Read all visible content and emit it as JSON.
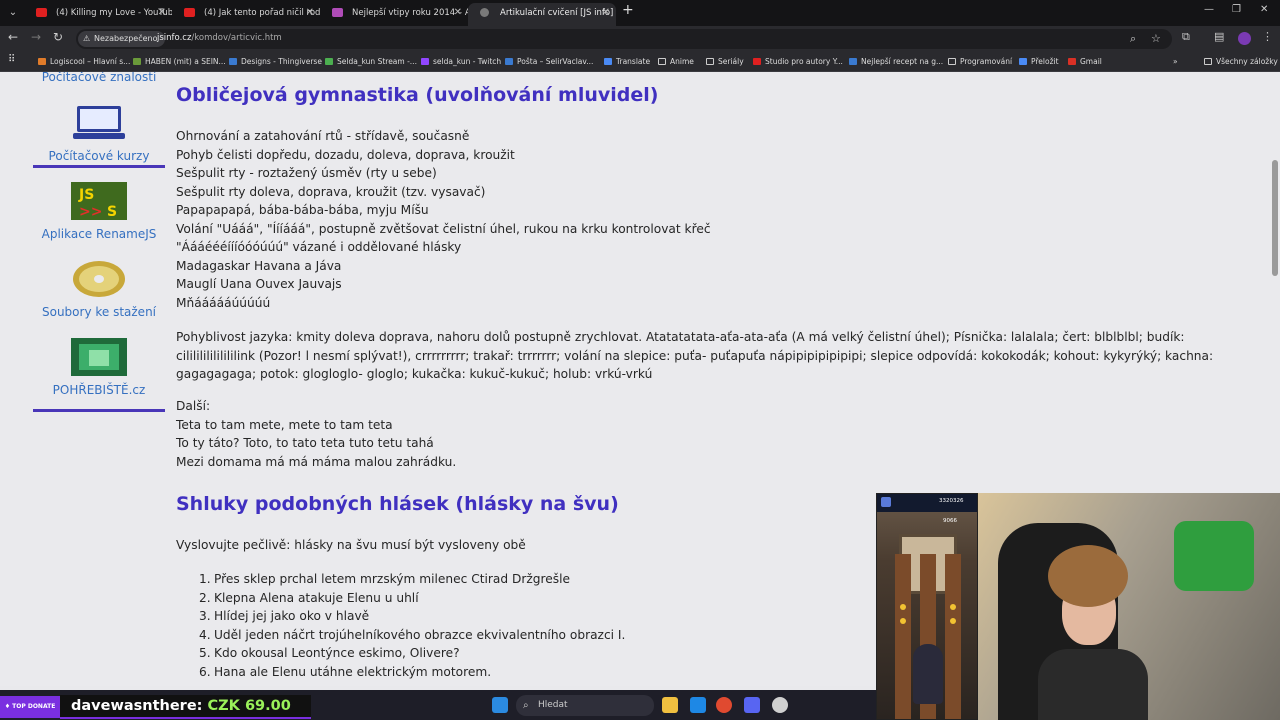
{
  "browser": {
    "tabs": [
      {
        "title": "(4) Killing my Love - YouTube",
        "favicon_color": "#e02020"
      },
      {
        "title": "(4) Jak tento pořad ničil rodin",
        "favicon_color": "#e02020"
      },
      {
        "title": "Nejlepší vtipy roku 2014 – Alik",
        "favicon_color": "#b04cb8"
      },
      {
        "title": "Artikulační cvičení [JS info]",
        "favicon_color": "#7a7a7a"
      }
    ],
    "security_label": "Nezabezpečeno",
    "url_host": "jsinfo.cz",
    "url_path": "/komdov/articvic.htm",
    "bookmarks": [
      {
        "label": "Logiscool – Hlavní s...",
        "color": "#e07b2a"
      },
      {
        "label": "HABEN (mit) a SEIN...",
        "color": "#6a9a3a"
      },
      {
        "label": "Designs - Thingiverse",
        "color": "#3a7ad0"
      },
      {
        "label": "Selda_kun Stream -...",
        "color": "#4caf50"
      },
      {
        "label": "selda_kun - Twitch",
        "color": "#9146ff"
      },
      {
        "label": "Pošta – SelirVaclav...",
        "color": "#3a7ad0"
      },
      {
        "label": "Translate",
        "color": "#4a8af4"
      },
      {
        "label": "Anime",
        "folder": true
      },
      {
        "label": "Seriály",
        "folder": true
      },
      {
        "label": "Studio pro autory Y...",
        "color": "#e02020"
      },
      {
        "label": "Nejlepší recept na g...",
        "color": "#3a7ad0"
      },
      {
        "label": "Programování",
        "folder": true
      },
      {
        "label": "Přeložit",
        "color": "#4a8af4"
      },
      {
        "label": "Gmail",
        "color": "#d93025"
      }
    ],
    "all_bookmarks": "Všechny záložky"
  },
  "sidebar": {
    "top_label": "Počítačové znalosti",
    "items": [
      {
        "label": "Počítačové kurzy",
        "icon": "laptop-icon"
      },
      {
        "label": "Aplikace RenameJS",
        "icon": "renamejs-logo"
      },
      {
        "label": "Soubory ke stažení",
        "icon": "disc-icon"
      },
      {
        "label": "POHŘEBIŠTĚ.cz",
        "icon": "cemetery-icon"
      }
    ]
  },
  "main": {
    "section1_title": "Obličejová gymnastika (uvolňování mluvidel)",
    "section1_lines": [
      "Ohrnování a zatahování rtů - střídavě, současně",
      "Pohyb čelisti dopředu, dozadu, doleva, doprava, kroužit",
      "Sešpulit rty - roztažený úsměv (rty u sebe)",
      "Sešpulit rty doleva, doprava, kroužit (tzv. vysavač)",
      "Papapapapá, bába-bába-bába, myju Míšu",
      "Volání \"Uááá\", \"Íííááá\", postupně zvětšovat čelistní úhel, rukou na krku kontrolovat křeč",
      "\"Áááéééíííóóóúúú\" vázané i oddělované hlásky",
      "Madagaskar Havana a Jáva",
      "Mauglí Uana Ouvex Jauvajs",
      "Mňáááááúúúúú"
    ],
    "tongue_paragraph": "Pohyblivost jazyka: kmity doleva doprava, nahoru dolů postupně zrychlovat. Atatatatata-aťa-ata-aťa (A má velký čelistní úhel); Písnička: lalalala; čert: blblblbl; budík: cililililililililink (Pozor! l nesmí splývat!), crrrrrrrrr; trakař: trrrrrrr; volání na slepice: puťa- puťapuťa nápipipipipipipi; slepice odpovídá: kokokodák; kohout: kykyrýký; kachna: gagagagaga; potok: glogloglo- gloglo; kukačka: kukuč-kukuč; holub: vrkú-vrkú",
    "other_label": "Další:",
    "other_lines": [
      "Teta to tam mete, mete to tam teta",
      "To ty táto? Toto, to tato teta tuto tetu tahá",
      "Mezi domama má má máma malou zahrádku."
    ],
    "section2_title": "Shluky podobných hlásek (hlásky na švu)",
    "section2_intro": "Vyslovujte pečlivě: hlásky na švu musí být vysloveny obě",
    "section2_list": [
      "Přes sklep prchal letem mrzským milenec Ctirad Držgrešle",
      "Klepna Alena atakuje Elenu u uhlí",
      "Hlídej jej jako oko v hlavě",
      "Uděl jeden náčrt trojúhelníkového obrazce ekvivalentního obrazci I.",
      "Kdo okousal Leontýnce eskimo, Olivere?",
      "Hana ale Elenu utáhne elektrickým motorem."
    ]
  },
  "stream": {
    "donate_label": "♦ TOP DONATE",
    "donor": "davewasnthere:",
    "amount": "CZK 69.00",
    "game_score": "3320326",
    "game_coins": "9066"
  },
  "taskbar": {
    "search_placeholder": "Hledat"
  }
}
